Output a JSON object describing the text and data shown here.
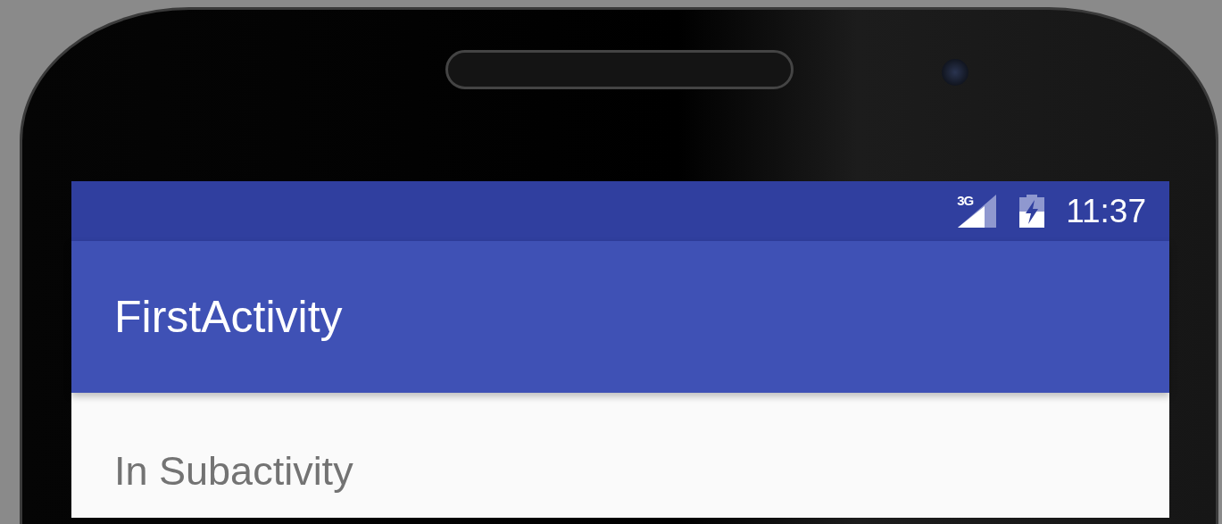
{
  "status_bar": {
    "network": "3G",
    "time": "11:37"
  },
  "app_bar": {
    "title": "FirstActivity"
  },
  "content": {
    "text": "In Subactivity"
  }
}
